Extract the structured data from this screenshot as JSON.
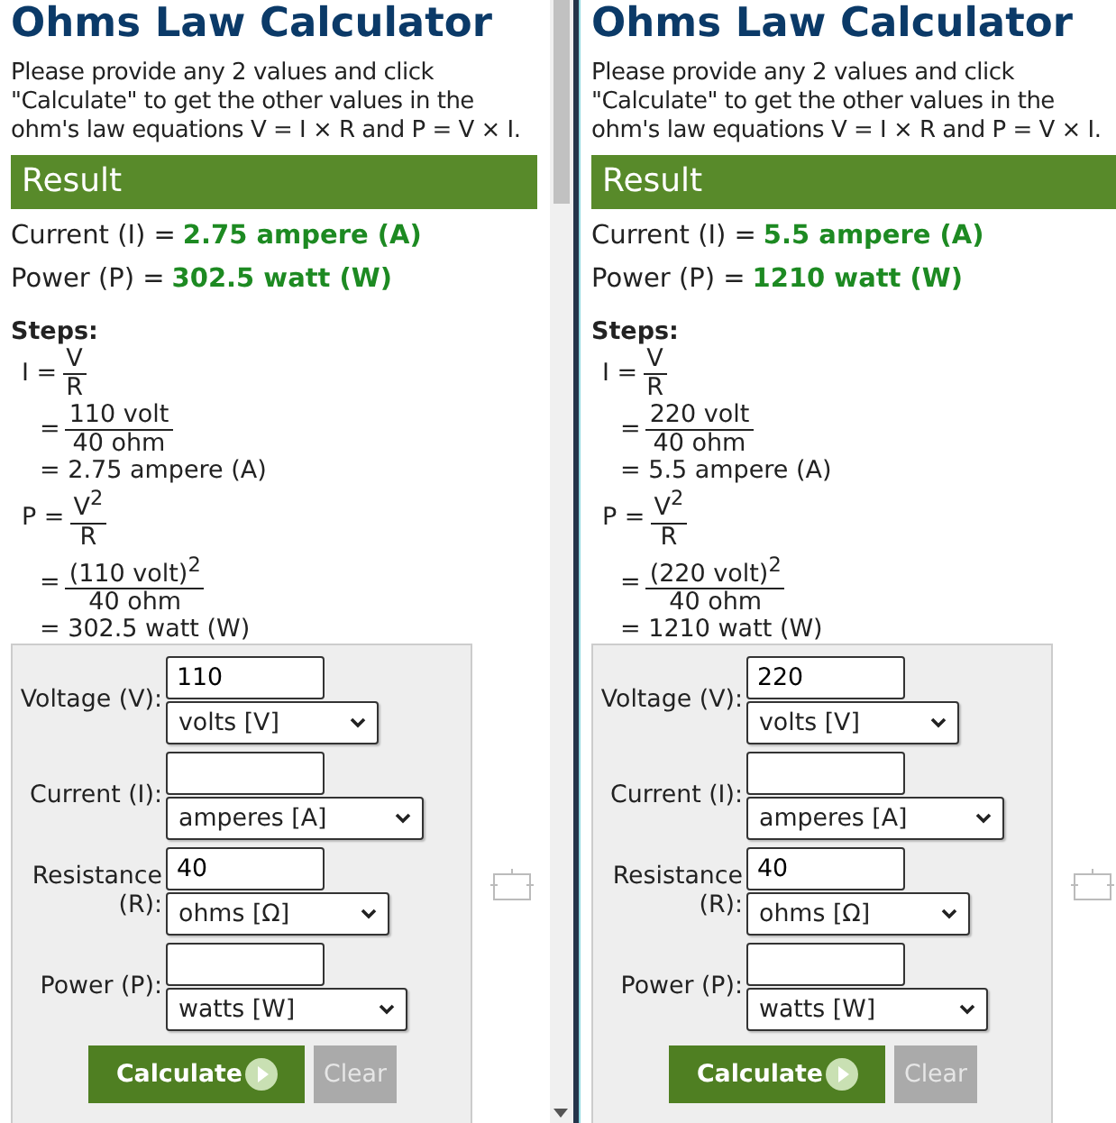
{
  "panels": [
    {
      "title": "Ohms Law Calculator",
      "intro": "Please provide any 2 values and click \"Calculate\" to get the other values in the ohm's law equations V = I × R and P = V × I.",
      "result_heading": "Result",
      "results": [
        {
          "label": "Current (I) =",
          "value": "2.75 ampere (A)"
        },
        {
          "label": "Power (P) =",
          "value": "302.5 watt (W)"
        }
      ],
      "steps_heading": "Steps:",
      "steps": [
        {
          "kind": "define",
          "lhs": "I =",
          "num": "V",
          "den": "R"
        },
        {
          "kind": "substitute",
          "lhs": "=",
          "num": "110 volt",
          "den": "40 ohm"
        },
        {
          "kind": "result",
          "text": "= 2.75 ampere (A)"
        },
        {
          "kind": "define",
          "lhs": "P =",
          "num": "V$^{2}$",
          "den": "R"
        },
        {
          "kind": "substitute",
          "lhs": "=",
          "num": "(110 volt)$^{2}$",
          "den": "40 ohm"
        },
        {
          "kind": "result",
          "text": "= 302.5 watt (W)"
        }
      ],
      "fields": [
        {
          "label": "Voltage (V):",
          "value": "110",
          "unit": "volts [V]"
        },
        {
          "label": "Current (I):",
          "unit": "amperes [A]"
        },
        {
          "label": "Resistance (R):",
          "value": "40",
          "unit": "ohms [Ω]"
        },
        {
          "label": "Power (P):",
          "unit": "watts [W]"
        }
      ],
      "buttons": [
        {
          "label": "Calculate",
          "kind": "primary"
        },
        {
          "label": "Clear",
          "kind": "secondary"
        }
      ]
    },
    {
      "title": "Ohms Law Calculator",
      "intro": "Please provide any 2 values and click \"Calculate\" to get the other values in the ohm's law equations V = I × R and P = V × I.",
      "result_heading": "Result",
      "results": [
        {
          "label": "Current (I) =",
          "value": "5.5 ampere (A)"
        },
        {
          "label": "Power (P) =",
          "value": "1210 watt (W)"
        }
      ],
      "steps_heading": "Steps:",
      "steps": [
        {
          "kind": "define",
          "lhs": "I =",
          "num": "V",
          "den": "R"
        },
        {
          "kind": "substitute",
          "lhs": "=",
          "num": "220 volt",
          "den": "40 ohm"
        },
        {
          "kind": "result",
          "text": "= 5.5 ampere (A)"
        },
        {
          "kind": "define",
          "lhs": "P =",
          "num": "V$^{2}$",
          "den": "R"
        },
        {
          "kind": "substitute",
          "lhs": "=",
          "num": "(220 volt)$^{2}$",
          "den": "40 ohm"
        },
        {
          "kind": "result",
          "text": "= 1210 watt (W)"
        }
      ],
      "fields": [
        {
          "label": "Voltage (V):",
          "value": "220",
          "unit": "volts [V]"
        },
        {
          "label": "Current (I):",
          "unit": "amperes [A]"
        },
        {
          "label": "Resistance (R):",
          "value": "40",
          "unit": "ohms [Ω]"
        },
        {
          "label": "Power (P):",
          "unit": "watts [W]"
        }
      ],
      "buttons": [
        {
          "label": "Calculate",
          "kind": "primary"
        },
        {
          "label": "Clear",
          "kind": "secondary"
        }
      ]
    }
  ]
}
